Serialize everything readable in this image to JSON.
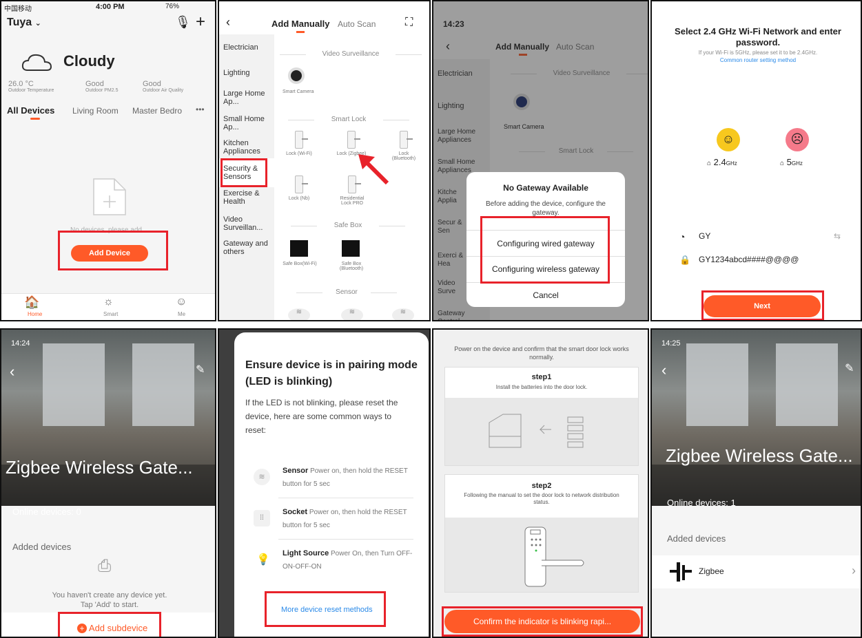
{
  "p1": {
    "carrier": "中国移动",
    "time": "4:00 PM",
    "battery": "76%",
    "home_name": "Tuya",
    "weather": "Cloudy",
    "temp": "26.0 °C",
    "temp_label": "Outdoor Temperature",
    "pm_value": "Good",
    "pm_label": "Outdoor PM2.5",
    "air_value": "Good",
    "air_label": "Outdoor Air Quality",
    "tabs": [
      "All Devices",
      "Living Room",
      "Master Bedro",
      "•••"
    ],
    "empty_hint": "No devices, please add",
    "add_button": "Add Device",
    "nav": [
      "Home",
      "Smart",
      "Me"
    ]
  },
  "p2": {
    "tab_manual": "Add Manually",
    "tab_scan": "Auto Scan",
    "categories": [
      "Electrician",
      "Lighting",
      "Large Home Ap...",
      "Small Home Ap...",
      "Kitchen Appliances",
      "Security & Sensors",
      "Exercise & Health",
      "Video Surveillan...",
      "Gateway and others"
    ],
    "sec_video": "Video Surveillance",
    "camera_label": "Smart Camera",
    "sec_lock": "Smart Lock",
    "locks": [
      "Lock (Wi-Fi)",
      "Lock (Zigbee)",
      "Lock (Bluetooth)",
      "Lock (Nb)",
      "Residential Lock PRO"
    ],
    "sec_safe": "Safe Box",
    "safes": [
      "Safe Box(Wi-Fi)",
      "Safe Box (Bluetooth)"
    ],
    "sec_sensor": "Sensor"
  },
  "p3": {
    "time": "14:23",
    "tab_manual": "Add Manually",
    "tab_scan": "Auto Scan",
    "categories": [
      "Electrician",
      "Lighting",
      "Large Home Appliances",
      "Small Home Appliances",
      "Kitche Applia",
      "Secur & Sen",
      "Exerci & Hea",
      "Video Surve",
      "Gateway Control"
    ],
    "sec_video": "Video Surveillance",
    "camera_label": "Smart Camera",
    "sec_lock": "Smart Lock",
    "dialog_title": "No Gateway Available",
    "dialog_text": "Before adding the device, configure the gateway.",
    "option_wired": "Configuring wired gateway",
    "option_wireless": "Configuring wireless gateway",
    "cancel": "Cancel"
  },
  "p4": {
    "title": "Select 2.4 GHz Wi-Fi Network and enter password.",
    "subtitle": "If your Wi-Fi is 5GHz, please set it to be 2.4GHz.",
    "link": "Common router setting method",
    "band_24": "2.4",
    "band_5": "5",
    "unit": "GHz",
    "ssid": "GY",
    "password": "GY1234abcd####@@@@",
    "next": "Next"
  },
  "p5": {
    "time": "14:24",
    "title": "Zigbee Wireless Gate...",
    "online": "Online devices: 0",
    "added": "Added devices",
    "empty1": "You haven't create any device yet.",
    "empty2": "Tap 'Add' to start.",
    "add_sub": "Add subdevice"
  },
  "p6": {
    "title": "Ensure device is in pairing mode (LED is blinking)",
    "intro": "If the LED is not blinking, please reset the device, here are some common ways to reset:",
    "items": [
      {
        "name": "Sensor",
        "text": "Power on, then hold the RESET button for 5 sec"
      },
      {
        "name": "Socket",
        "text": "Power on, then hold the RESET button for 5 sec"
      },
      {
        "name": "Light Source",
        "text": "Power On, then Turn OFF-ON-OFF-ON"
      }
    ],
    "more": "More device reset methods"
  },
  "p7": {
    "header": "Power on the device and confirm that the smart door lock works normally.",
    "step1_title": "step1",
    "step1_text": "Install the batteries into the door lock.",
    "step2_title": "step2",
    "step2_text": "Following the manual to set the door lock to network distribution status.",
    "confirm": "Confirm the indicator is blinking rapi..."
  },
  "p8": {
    "time": "14:25",
    "title": "Zigbee Wireless Gate...",
    "online": "Online devices: 1",
    "added": "Added devices",
    "device": "Zigbee"
  }
}
